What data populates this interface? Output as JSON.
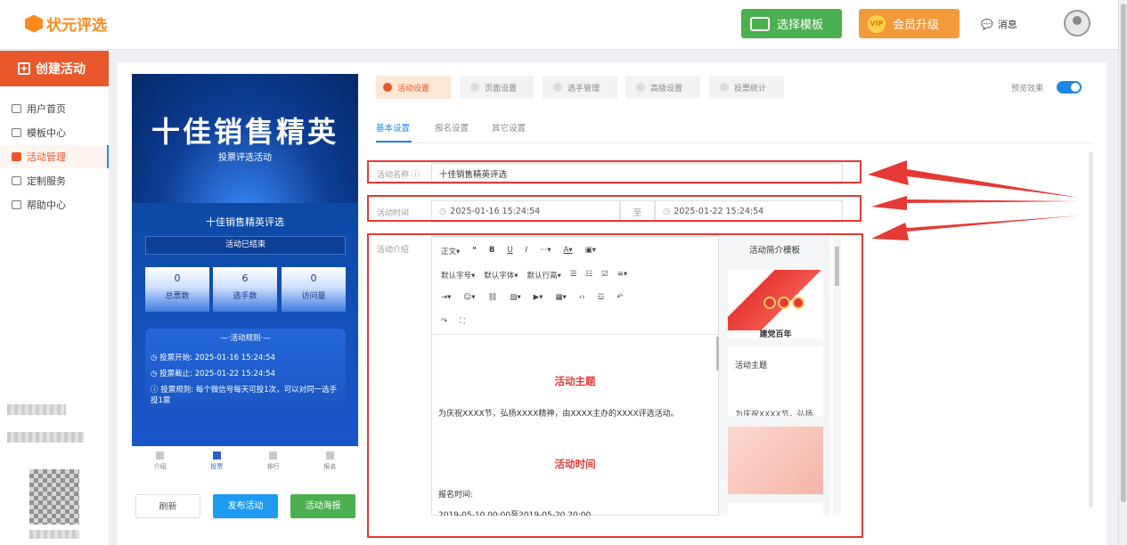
{
  "app": {
    "logo_text": "状元评选"
  },
  "topbar": {
    "select_template": "选择模板",
    "vip_badge": "VIP",
    "member_upgrade": "会员升级",
    "messages": "消息"
  },
  "sidebar": {
    "create_label": "创建活动",
    "items": [
      {
        "label": "用户首页",
        "active": false
      },
      {
        "label": "模板中心",
        "active": false
      },
      {
        "label": "活动管理",
        "active": true
      },
      {
        "label": "定制服务",
        "active": false
      },
      {
        "label": "帮助中心",
        "active": false
      }
    ]
  },
  "phone": {
    "hero_title": "十佳销售精英",
    "hero_subtitle": "投票评选活动",
    "event_title": "十佳销售精英评选",
    "status": "活动已结束",
    "stats": [
      {
        "value": "0",
        "label": "总票数"
      },
      {
        "value": "6",
        "label": "选手数"
      },
      {
        "value": "0",
        "label": "访问量"
      }
    ],
    "rules_heading": "—·活动规则·—",
    "rules": [
      "投票开始: 2025-01-16 15:24:54",
      "投票截止: 2025-01-22 15:24:54",
      "投票规则: 每个微信号每天可投1次，可以对同一选手投1票"
    ],
    "tabs": [
      "介绍",
      "投票",
      "排行",
      "报名"
    ],
    "active_tab": "投票"
  },
  "actions": {
    "refresh": "刷新",
    "publish": "发布活动",
    "poster": "活动海报"
  },
  "settings_tabs": [
    "活动设置",
    "页面设置",
    "选手管理",
    "高级设置",
    "投票统计"
  ],
  "preview_label": "预览效果",
  "sub_tabs": [
    "基本设置",
    "报名设置",
    "其它设置"
  ],
  "form": {
    "name_label": "活动名称",
    "name_value": "十佳销售精英评选",
    "time_label": "活动时间",
    "time_start": "2025-01-16 15:24:54",
    "time_sep": "至",
    "time_end": "2025-01-22 15:24:54",
    "intro_label": "活动介绍"
  },
  "editor": {
    "toolbar_row1": [
      "正文▾",
      "❝",
      "B",
      "U",
      "I",
      "···▾",
      "A▾",
      "▣▾"
    ],
    "toolbar_row2": [
      "默认字号▾",
      "默认字体▾",
      "默认行高▾",
      "☰",
      "☷",
      "☑",
      "≡▾"
    ],
    "toolbar_row3": [
      "⇥▾",
      "☺▾",
      "⛓",
      "▨▾",
      "▶▾",
      "▦▾",
      "‹›",
      "☲",
      "↶"
    ],
    "toolbar_row4": [
      "↷",
      "⛶"
    ],
    "heading1": "活动主题",
    "para1": "为庆祝XXXX节，弘扬XXXX精神，由XXXX主办的XXXX评选活动。",
    "heading2": "活动时间",
    "para2": "报名时间:",
    "para3": "2019-05-10 00:00至2019-05-20 20:00"
  },
  "template_panel": {
    "heading": "活动简介模板",
    "card1_caption": "建党百年",
    "card2_title": "活动主题",
    "card2_text": "为庆祝XXXX节，弘扬"
  },
  "colors": {
    "accent": "#e8582a",
    "primary": "#1e88e5",
    "annotation": "#e53935"
  }
}
